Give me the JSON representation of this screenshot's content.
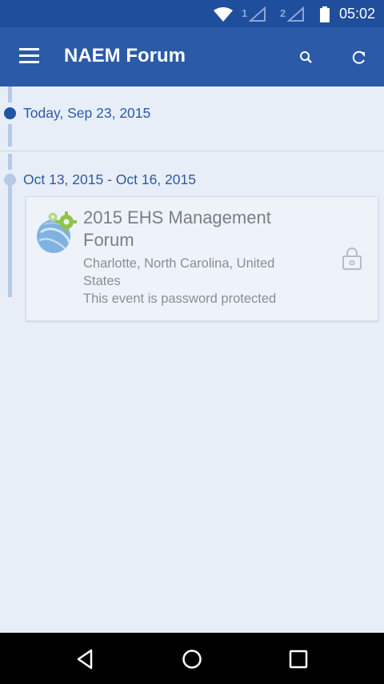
{
  "status_bar": {
    "time": "05:02",
    "sim1": "1",
    "sim2": "2",
    "icons": [
      "wifi-icon",
      "signal-icon",
      "battery-icon"
    ]
  },
  "app_bar": {
    "title": "NAEM Forum",
    "background": "#2a5aa8",
    "icons": [
      "hamburger-menu-icon",
      "search-icon",
      "refresh-icon"
    ]
  },
  "timeline": {
    "today_label": "Today, Sep 23, 2015",
    "groups": [
      {
        "date_range": "Oct 13, 2015 - Oct 16, 2015",
        "events": [
          {
            "title": "2015 EHS Management Forum",
            "location": "Charlotte, North Carolina, United States",
            "note": "This event is password protected",
            "icon": "lock-icon",
            "logo": "gear-globe-logo"
          }
        ]
      }
    ]
  },
  "nav_bar": {
    "icons": [
      "back-icon",
      "home-icon",
      "recents-icon"
    ]
  }
}
